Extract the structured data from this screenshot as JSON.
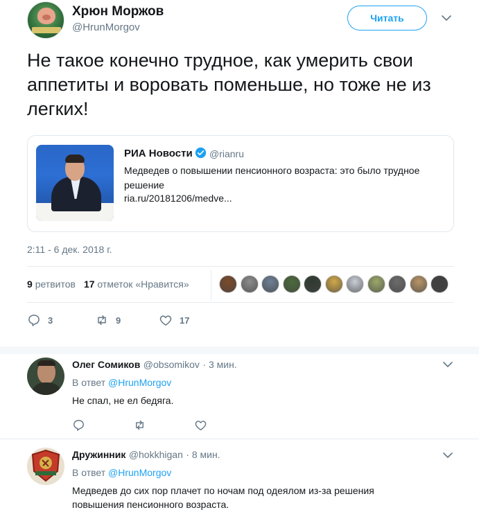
{
  "tweet": {
    "author_name": "Хрюн Моржов",
    "author_handle": "@HrunMorgov",
    "follow_label": "Читать",
    "text": "Не такое конечно трудное, как умерить свои аппетиты и воровать поменьше, но тоже не из легких!",
    "timestamp": "2:11 - 6 дек. 2018 г.",
    "retweets_count": "9",
    "retweets_label": "ретвитов",
    "likes_count": "17",
    "likes_label": "отметок «Нравится»",
    "reply_action_count": "3",
    "retweet_action_count": "9",
    "like_action_count": "17"
  },
  "quote": {
    "name": "РИА Новости",
    "handle": "@rianru",
    "text": "Медведев о повышении пенсионного возраста: это было трудное решение",
    "link": "ria.ru/20181206/medve..."
  },
  "likers": [
    "#7a4a2b",
    "#8c8c8c",
    "#6d7f94",
    "#4b6a3b",
    "#2f3a2f",
    "#d0a84a",
    "#c9ced6",
    "#9aa86a",
    "#6b6b6b",
    "#b89468",
    "#3f3f3f"
  ],
  "replies": [
    {
      "name": "Олег Сомиков",
      "handle": "@obsomikov",
      "time": "· 3 мин.",
      "in_reply_prefix": "В ответ",
      "in_reply_to": "@HrunMorgov",
      "text": "Не спал, не ел бедяга."
    },
    {
      "name": "Дружинник",
      "handle": "@hokkhigan",
      "time": "· 8 мин.",
      "in_reply_prefix": "В ответ",
      "in_reply_to": "@HrunMorgov",
      "text": "Медведев до сих пор плачет по ночам под одеялом из-за решения повышения пенсионного возраста."
    }
  ],
  "colors": {
    "accent": "#1da1f2",
    "muted": "#657786",
    "text": "#14171a",
    "border": "#e6ecf0"
  }
}
